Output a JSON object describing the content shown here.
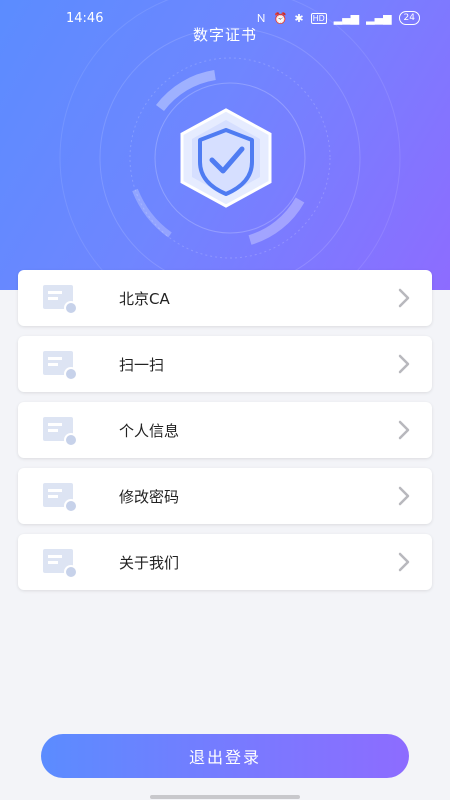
{
  "status_bar": {
    "time": "14:46",
    "icons": [
      "nfc-icon",
      "alarm-icon",
      "bluetooth-icon",
      "hd-icon",
      "signal-icon",
      "signal-icon"
    ],
    "battery": "24"
  },
  "header": {
    "title": "数字证书",
    "gradient_colors": [
      "#5b8cff",
      "#8d6cff"
    ]
  },
  "menu": {
    "items": [
      {
        "label": "北京CA",
        "icon": "certificate-icon"
      },
      {
        "label": "扫一扫",
        "icon": "certificate-icon"
      },
      {
        "label": "个人信息",
        "icon": "certificate-icon"
      },
      {
        "label": "修改密码",
        "icon": "certificate-icon"
      },
      {
        "label": "关于我们",
        "icon": "certificate-icon"
      }
    ]
  },
  "footer": {
    "logout_label": "退出登录"
  }
}
